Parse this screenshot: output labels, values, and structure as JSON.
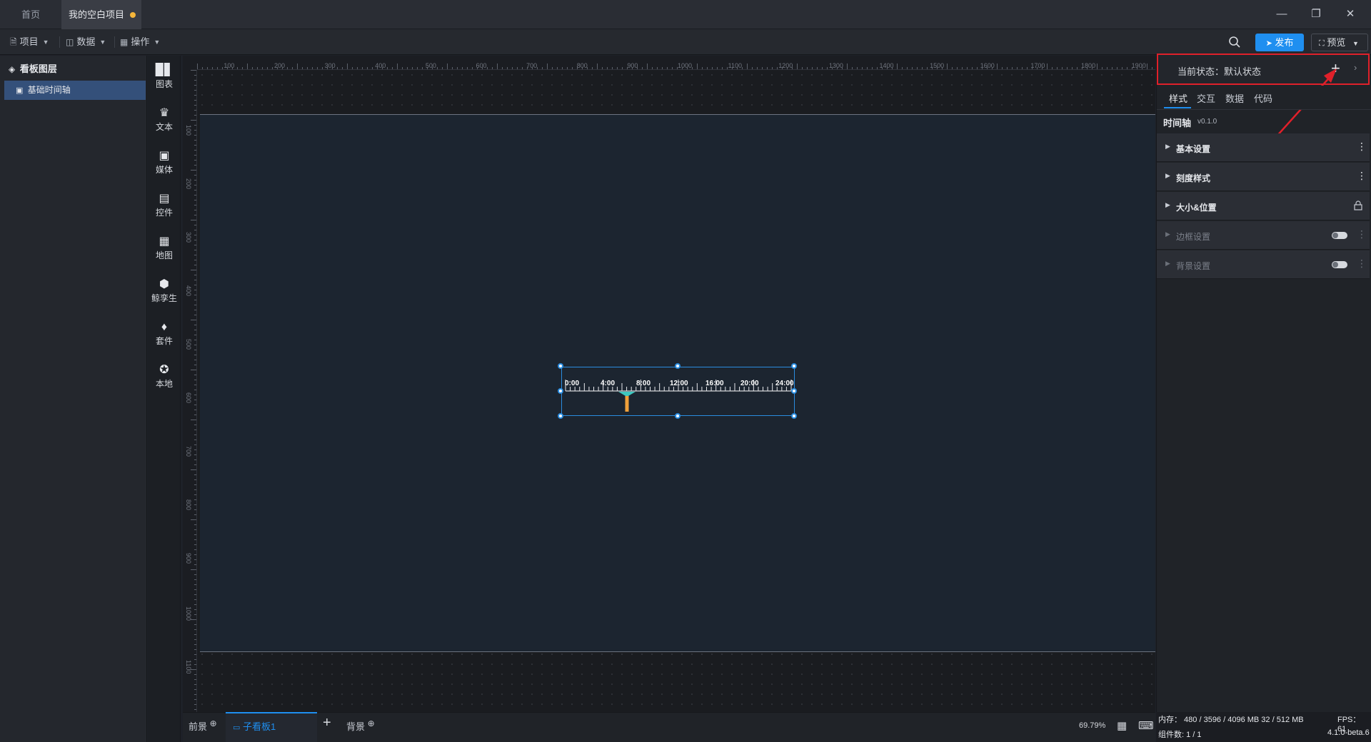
{
  "tabs": [
    {
      "label": "首页"
    },
    {
      "label": "我的空白项目"
    }
  ],
  "toolbar": {
    "menus": [
      {
        "label": "项目"
      },
      {
        "label": "数据"
      },
      {
        "label": "操作"
      }
    ],
    "publish_label": "发布",
    "preview_label": "预览"
  },
  "layers": {
    "title": "看板图层",
    "items": [
      {
        "label": "基础时间轴"
      }
    ]
  },
  "components": [
    {
      "label": "图表",
      "icon": "bar-chart-icon"
    },
    {
      "label": "文本",
      "icon": "text-icon"
    },
    {
      "label": "媒体",
      "icon": "media-icon"
    },
    {
      "label": "控件",
      "icon": "control-icon"
    },
    {
      "label": "地图",
      "icon": "map-icon"
    },
    {
      "label": "孪生",
      "icon": "twin-icon"
    },
    {
      "label": "套件",
      "icon": "kit-icon"
    },
    {
      "label": "本地",
      "icon": "plugin-icon"
    }
  ],
  "ruler": {
    "top": [
      "100",
      "200",
      "300",
      "400",
      "500",
      "600",
      "700",
      "800",
      "900",
      "1000",
      "1100",
      "1200",
      "1300",
      "1400",
      "1500",
      "1600",
      "1700",
      "1800",
      "1900"
    ],
    "left": [
      "100",
      "200",
      "300",
      "400",
      "500",
      "600",
      "700",
      "800",
      "900",
      "1000",
      "1100"
    ]
  },
  "timeline": {
    "labels": [
      "0:00",
      "4:00",
      "8:00",
      "12:00",
      "16:00",
      "20:00",
      "24:00"
    ]
  },
  "bottom": {
    "tabs": [
      {
        "label": "前景"
      },
      {
        "label": "子看板1"
      },
      {
        "label": "背景"
      }
    ],
    "zoom": "69.79%"
  },
  "right_panel": {
    "state_label": "当前状态：默认状态",
    "tabs": [
      {
        "label": "样式"
      },
      {
        "label": "交互"
      },
      {
        "label": "数据"
      },
      {
        "label": "代码"
      }
    ],
    "component_name": "时间轴",
    "version": "v0.1.0",
    "sections": [
      {
        "label": "基本设置"
      },
      {
        "label": "刻度样式"
      },
      {
        "label": "大小&位置"
      },
      {
        "label": "边框设置"
      },
      {
        "label": "背景设置"
      }
    ]
  },
  "status": {
    "memory": "内存： 480 / 3596 / 4096 MB  32 / 512 MB",
    "fps": "FPS： 61",
    "count": "组件数: 1 / 1",
    "version": "4.1.0-beta.6"
  },
  "colors": {
    "accent": "#1f8ff0",
    "highlight_border": "#e0202a",
    "annotation_arrow": "#e0202a",
    "unsaved_dot": "#f5b63a",
    "timeline_pointer_top": "#3ec8c0",
    "timeline_pointer_stem": "#f0a13a"
  }
}
